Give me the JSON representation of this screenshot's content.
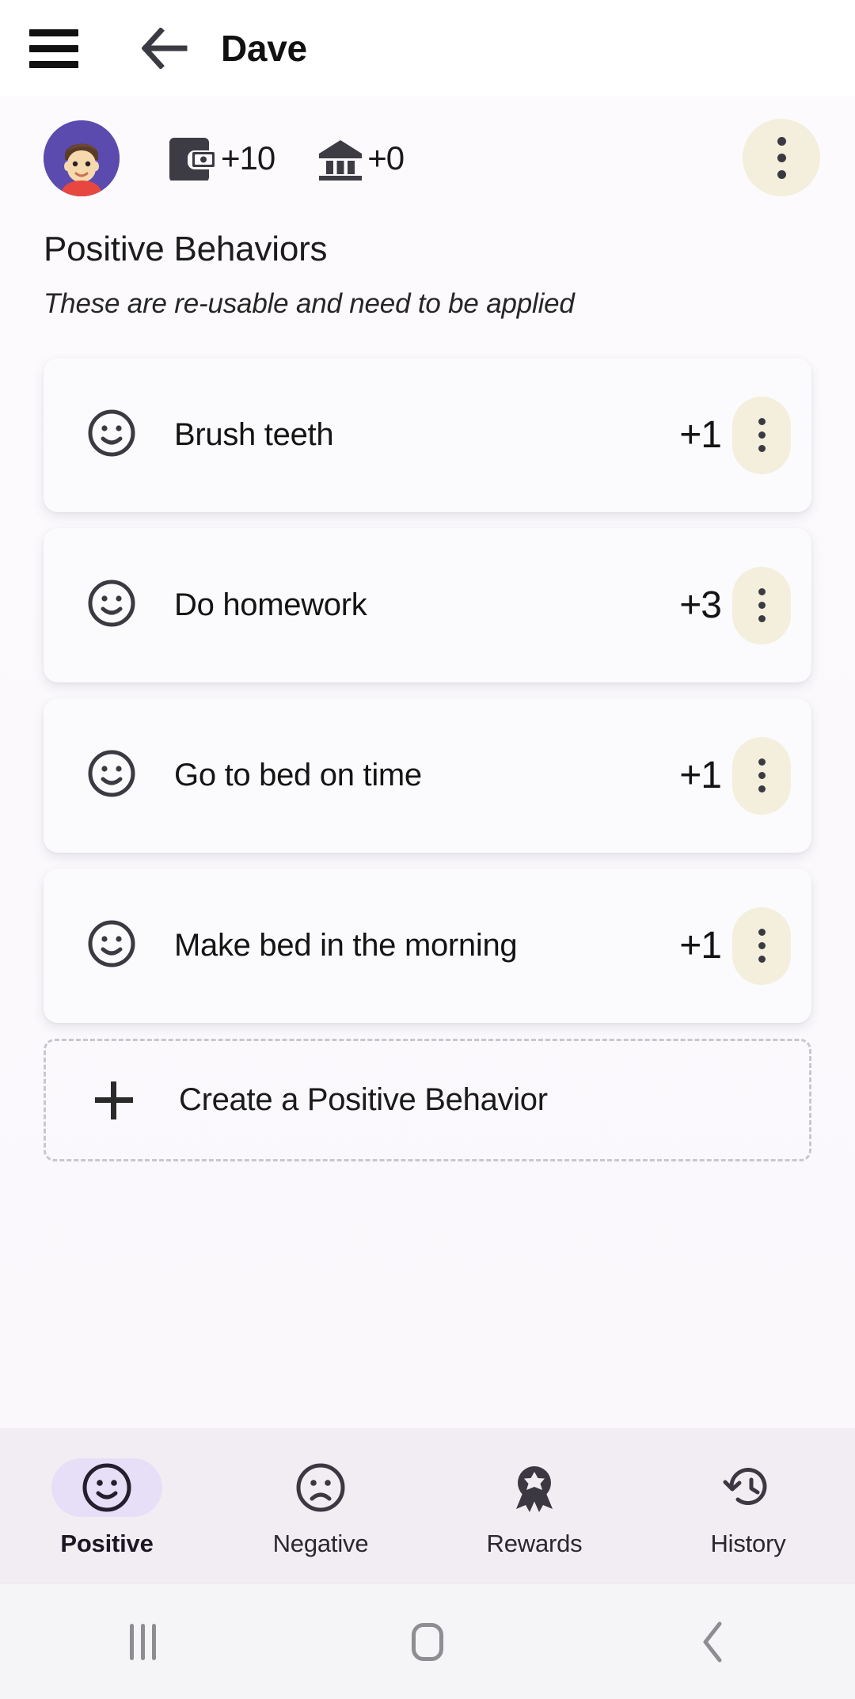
{
  "appbar": {
    "menu_icon": "hamburger-menu-icon",
    "back_icon": "arrow-left-icon",
    "title": "Dave"
  },
  "profile": {
    "avatar_icon": "user-avatar",
    "avatar_bg": "#5B4BAE",
    "stats": [
      {
        "icon": "wallet-icon",
        "separator": ": ",
        "value": "+10"
      },
      {
        "icon": "bank-icon",
        "separator": ": ",
        "value": "+0"
      }
    ],
    "overflow_icon": "more-vertical-icon",
    "overflow_bg": "#F3EFDC"
  },
  "section": {
    "title": "Positive Behaviors",
    "subtitle": "These are re-usable and need to be applied"
  },
  "behaviors": [
    {
      "icon": "smiley-face-icon",
      "label": "Brush teeth",
      "points": "+1",
      "menu_icon": "more-vertical-icon"
    },
    {
      "icon": "smiley-face-icon",
      "label": "Do homework",
      "points": "+3",
      "menu_icon": "more-vertical-icon"
    },
    {
      "icon": "smiley-face-icon",
      "label": "Go to bed on time",
      "points": "+1",
      "menu_icon": "more-vertical-icon"
    },
    {
      "icon": "smiley-face-icon",
      "label": "Make bed in the morning",
      "points": "+1",
      "menu_icon": "more-vertical-icon"
    }
  ],
  "create_button": {
    "icon": "plus-icon",
    "label": "Create a Positive Behavior"
  },
  "tabbar": {
    "active_index": 0,
    "active_pill_color": "#E7DFF7",
    "background": "#F2EDF3",
    "tabs": [
      {
        "label": "Positive",
        "icon": "smiley-face-icon"
      },
      {
        "label": "Negative",
        "icon": "frowny-face-icon"
      },
      {
        "label": "Rewards",
        "icon": "award-ribbon-icon"
      },
      {
        "label": "History",
        "icon": "clock-history-icon"
      }
    ]
  },
  "sysnav": {
    "buttons": [
      {
        "name": "recents-button",
        "icon": "recents-icon"
      },
      {
        "name": "home-button",
        "icon": "home-icon"
      },
      {
        "name": "back-button",
        "icon": "chevron-left-icon"
      }
    ]
  }
}
